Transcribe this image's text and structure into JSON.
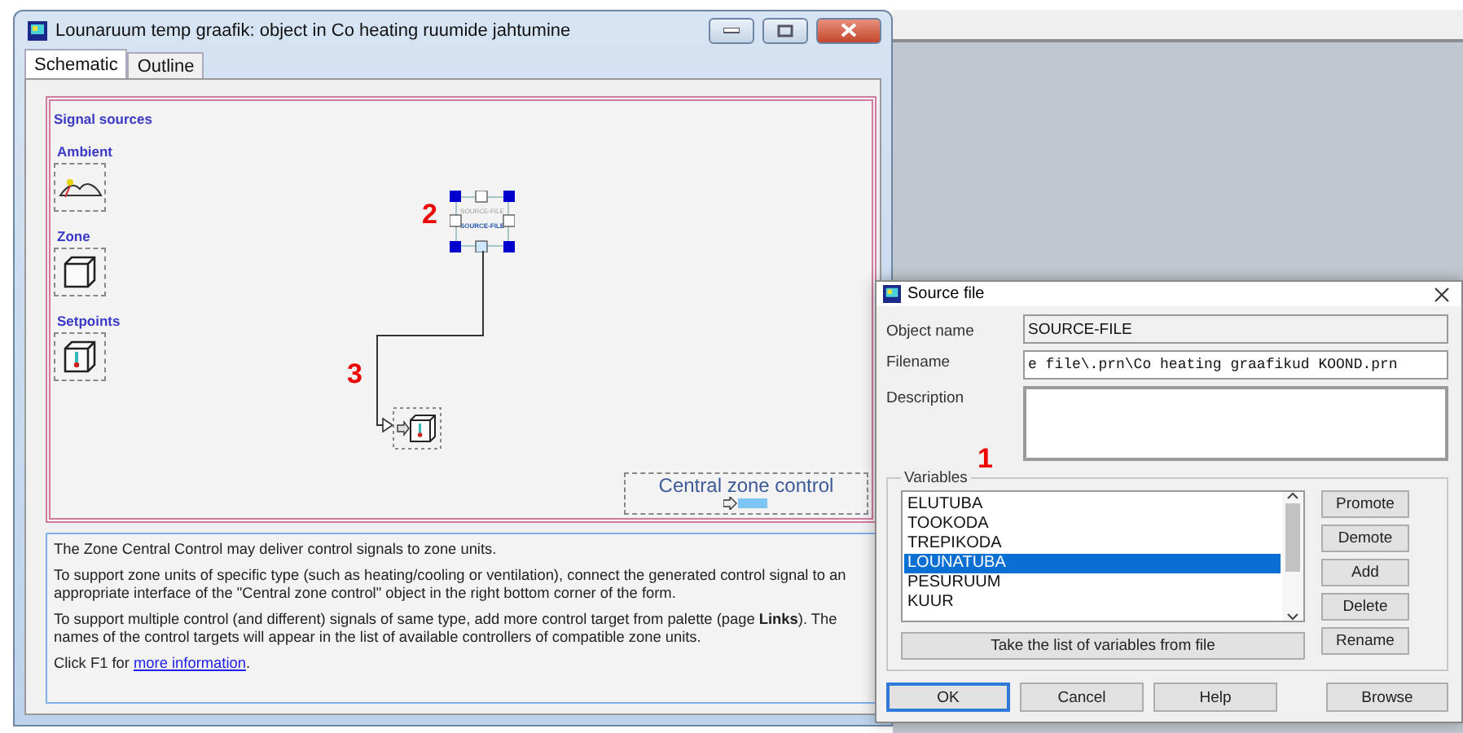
{
  "main_window": {
    "title": "Lounaruum temp graafik: object in Co heating ruumide jahtumine",
    "tabs": [
      {
        "label": "Schematic",
        "selected": true
      },
      {
        "label": "Outline",
        "selected": false
      }
    ],
    "canvas": {
      "palette_title": "Signal sources",
      "palette": [
        {
          "label": "Ambient",
          "kind": "ambient"
        },
        {
          "label": "Zone",
          "kind": "zone"
        },
        {
          "label": "Setpoints",
          "kind": "setpoint"
        }
      ],
      "source_node": {
        "labels": [
          "SOURCE-FILE",
          "SOURCE-FILE"
        ],
        "selected": true
      },
      "central_control": {
        "label": "Central zone control"
      },
      "annotations": [
        "2",
        "3"
      ]
    },
    "info": {
      "paragraphs": [
        "The Zone Central Control may deliver control signals to zone units.",
        "To support zone units of specific type (such as heating/cooling or ventilation), connect the generated control signal to an appropriate interface of  the \"Central zone control\" object in the right bottom corner of the form.",
        "To support multiple control (and different) signals of same type, add more control target from palette (page **Links**). The names of the control targets will appear in the list of available controllers of compatible zone units."
      ],
      "help_prefix": "Click F1 for ",
      "help_link": "more information",
      "help_suffix": "."
    }
  },
  "dialog": {
    "title": "Source file",
    "fields": [
      {
        "label": "Object name",
        "value": "SOURCE-FILE",
        "kind": "readonly"
      },
      {
        "label": "Filename",
        "value": "e file\\.prn\\Co heating graafikud KOOND.prn",
        "kind": "text"
      },
      {
        "label": "Description",
        "kind": "memo"
      }
    ],
    "annotation": "1",
    "variables": {
      "title": "Variables",
      "items": [
        {
          "label": "ELUTUBA",
          "selected": false
        },
        {
          "label": "TOOKODA",
          "selected": false
        },
        {
          "label": "TREPIKODA",
          "selected": false
        },
        {
          "label": "LOUNATUBA",
          "selected": true
        },
        {
          "label": "PESURUUM",
          "selected": false
        },
        {
          "label": "KUUR",
          "selected": false
        }
      ],
      "side_buttons": [
        "Promote",
        "Demote",
        "Add",
        "Delete",
        "Rename"
      ],
      "take_button": "Take the list of variables from file"
    },
    "buttons": [
      {
        "label": "OK",
        "default": true
      },
      {
        "label": "Cancel",
        "default": false
      },
      {
        "label": "Help",
        "default": false
      },
      {
        "label": "Browse",
        "default": false
      }
    ]
  }
}
